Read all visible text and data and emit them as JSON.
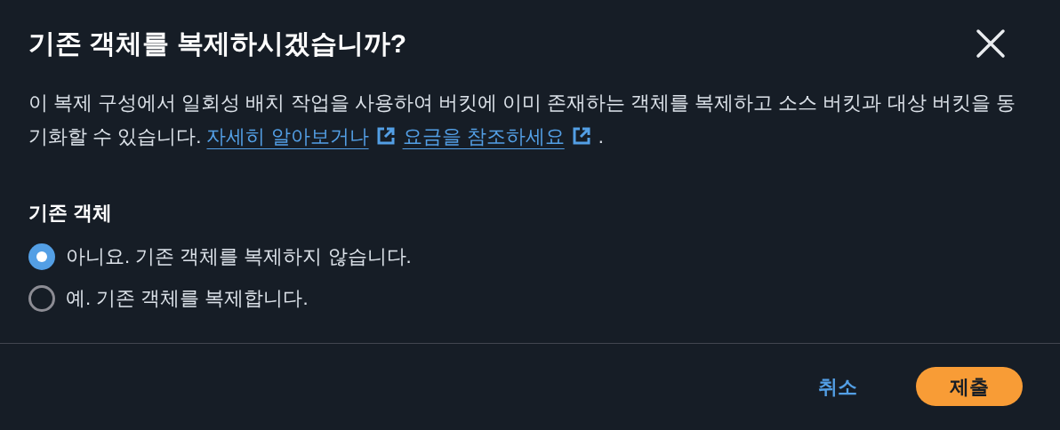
{
  "dialog": {
    "title": "기존 객체를 복제하시겠습니까?",
    "description": {
      "text": "이 복제 구성에서 일회성 배치 작업을 사용하여 버킷에 이미 존재하는 객체를 복제하고 소스 버킷과 대상 버킷을 동기화할 수 있습니다.",
      "links": [
        "자세히 알아보거나",
        "요금을 참조하세요"
      ],
      "end": "."
    },
    "field": {
      "label": "기존 객체",
      "options": [
        {
          "label": "아니요. 기존 객체를 복제하지 않습니다.",
          "selected": true
        },
        {
          "label": "예. 기존 객체를 복제합니다.",
          "selected": false
        }
      ]
    },
    "buttons": [
      {
        "label": "취소",
        "kind": "link"
      },
      {
        "label": "제출",
        "kind": "primary"
      }
    ]
  }
}
